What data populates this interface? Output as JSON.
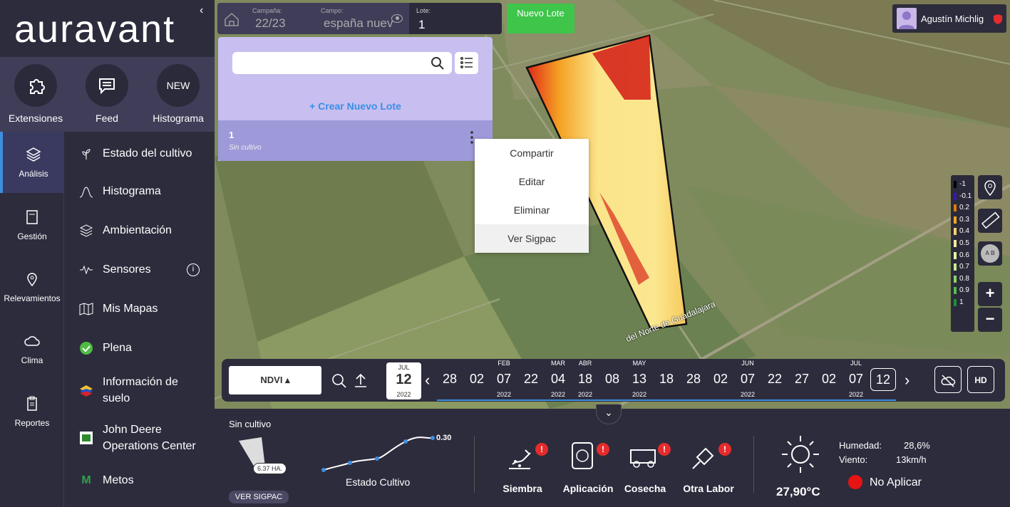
{
  "brand": {
    "logo": "auravant"
  },
  "shortcuts": [
    {
      "label": "Extensiones",
      "icon": "puzzle-icon"
    },
    {
      "label": "Feed",
      "icon": "chat-icon"
    },
    {
      "label": "Histograma",
      "icon": "new-badge",
      "badge": "NEW"
    }
  ],
  "leftnav": [
    {
      "label": "Análisis",
      "icon": "layers-icon",
      "active": true
    },
    {
      "label": "Gestión",
      "icon": "book-icon"
    },
    {
      "label": "Relevamientos",
      "icon": "pin-icon"
    },
    {
      "label": "Clima",
      "icon": "cloud-icon"
    },
    {
      "label": "Reportes",
      "icon": "clipboard-icon"
    }
  ],
  "menu": [
    {
      "label": "Estado del cultivo",
      "icon": "plant-icon"
    },
    {
      "label": "Histograma",
      "icon": "bell-curve-icon"
    },
    {
      "label": "Ambientación",
      "icon": "layers-icon"
    },
    {
      "label": "Sensores",
      "icon": "signal-icon"
    },
    {
      "label": "Mis Mapas",
      "icon": "map-icon"
    },
    {
      "label": "Plena",
      "icon": "plena-icon"
    },
    {
      "label": "Información de suelo",
      "icon": "soil-icon"
    },
    {
      "label": "John Deere Operations Center",
      "icon": "john-deere-icon"
    },
    {
      "label": "Metos",
      "icon": "metos-icon",
      "glyph": "M"
    }
  ],
  "topbar": {
    "campaign_label": "Campaña:",
    "campaign_value": "22/23",
    "field_label": "Campo:",
    "field_value": "españa nuev",
    "lote_label": "Lote:",
    "lote_value": "1",
    "new_lote_button": "Nuevo Lote"
  },
  "user": {
    "name": "Agustín Michlig"
  },
  "lote_panel": {
    "search_placeholder": "",
    "create_label": "+  Crear Nuevo Lote",
    "items": [
      {
        "name": "1",
        "crop": "Sin cultivo"
      }
    ]
  },
  "context_menu": {
    "items": [
      "Compartir",
      "Editar",
      "Eliminar",
      "Ver Sigpac"
    ]
  },
  "legend": [
    {
      "value": "-1",
      "color": "#000000"
    },
    {
      "value": "-0.1",
      "color": "#3b1aa8"
    },
    {
      "value": "0.2",
      "color": "#e07a12"
    },
    {
      "value": "0.3",
      "color": "#f3a623"
    },
    {
      "value": "0.4",
      "color": "#f7cf6a"
    },
    {
      "value": "0.5",
      "color": "#f4ec9a"
    },
    {
      "value": "0.6",
      "color": "#e6f3a3"
    },
    {
      "value": "0.7",
      "color": "#c4ec8c"
    },
    {
      "value": "0.8",
      "color": "#8ad56a"
    },
    {
      "value": "0.9",
      "color": "#4cbd4e"
    },
    {
      "value": "1",
      "color": "#1f8e3a"
    }
  ],
  "map_controls": {
    "zoom_in": "+",
    "zoom_out": "−",
    "road_label": "del Norte de Guadalajara",
    "ab_label": "A B"
  },
  "datebar": {
    "index": "NDVI",
    "current": {
      "month": "JUL",
      "day": "12",
      "year": "2022"
    },
    "dates": [
      "28",
      "02",
      "07",
      "22",
      "04",
      "18",
      "08",
      "13",
      "18",
      "28",
      "02",
      "07",
      "22",
      "27",
      "02",
      "07",
      "12"
    ],
    "months": [
      "FEB",
      "MAR",
      "ABR",
      "MAY",
      "JUN",
      "JUL"
    ],
    "years": [
      "2022",
      "2022",
      "2022",
      "2022",
      "2022",
      "2022"
    ],
    "hd_label": "HD"
  },
  "bottom": {
    "crop": "Sin cultivo",
    "area": "6.37 HA.",
    "sigpac_button": "VER SIGPAC",
    "trend_value": "0.30",
    "trend_label": "Estado Cultivo",
    "tasks": [
      {
        "label": "Siembra",
        "icon": "sowing-icon"
      },
      {
        "label": "Aplicación",
        "icon": "application-icon"
      },
      {
        "label": "Cosecha",
        "icon": "harvester-icon"
      },
      {
        "label": "Otra Labor",
        "icon": "shovel-icon"
      }
    ],
    "weather": {
      "temperature": "27,90°C",
      "humidity_label": "Humedad:",
      "humidity": "28,6%",
      "wind_label": "Viento:",
      "wind": "13km/h",
      "apply_status": "No Aplicar",
      "status_color": "#e81313"
    }
  }
}
